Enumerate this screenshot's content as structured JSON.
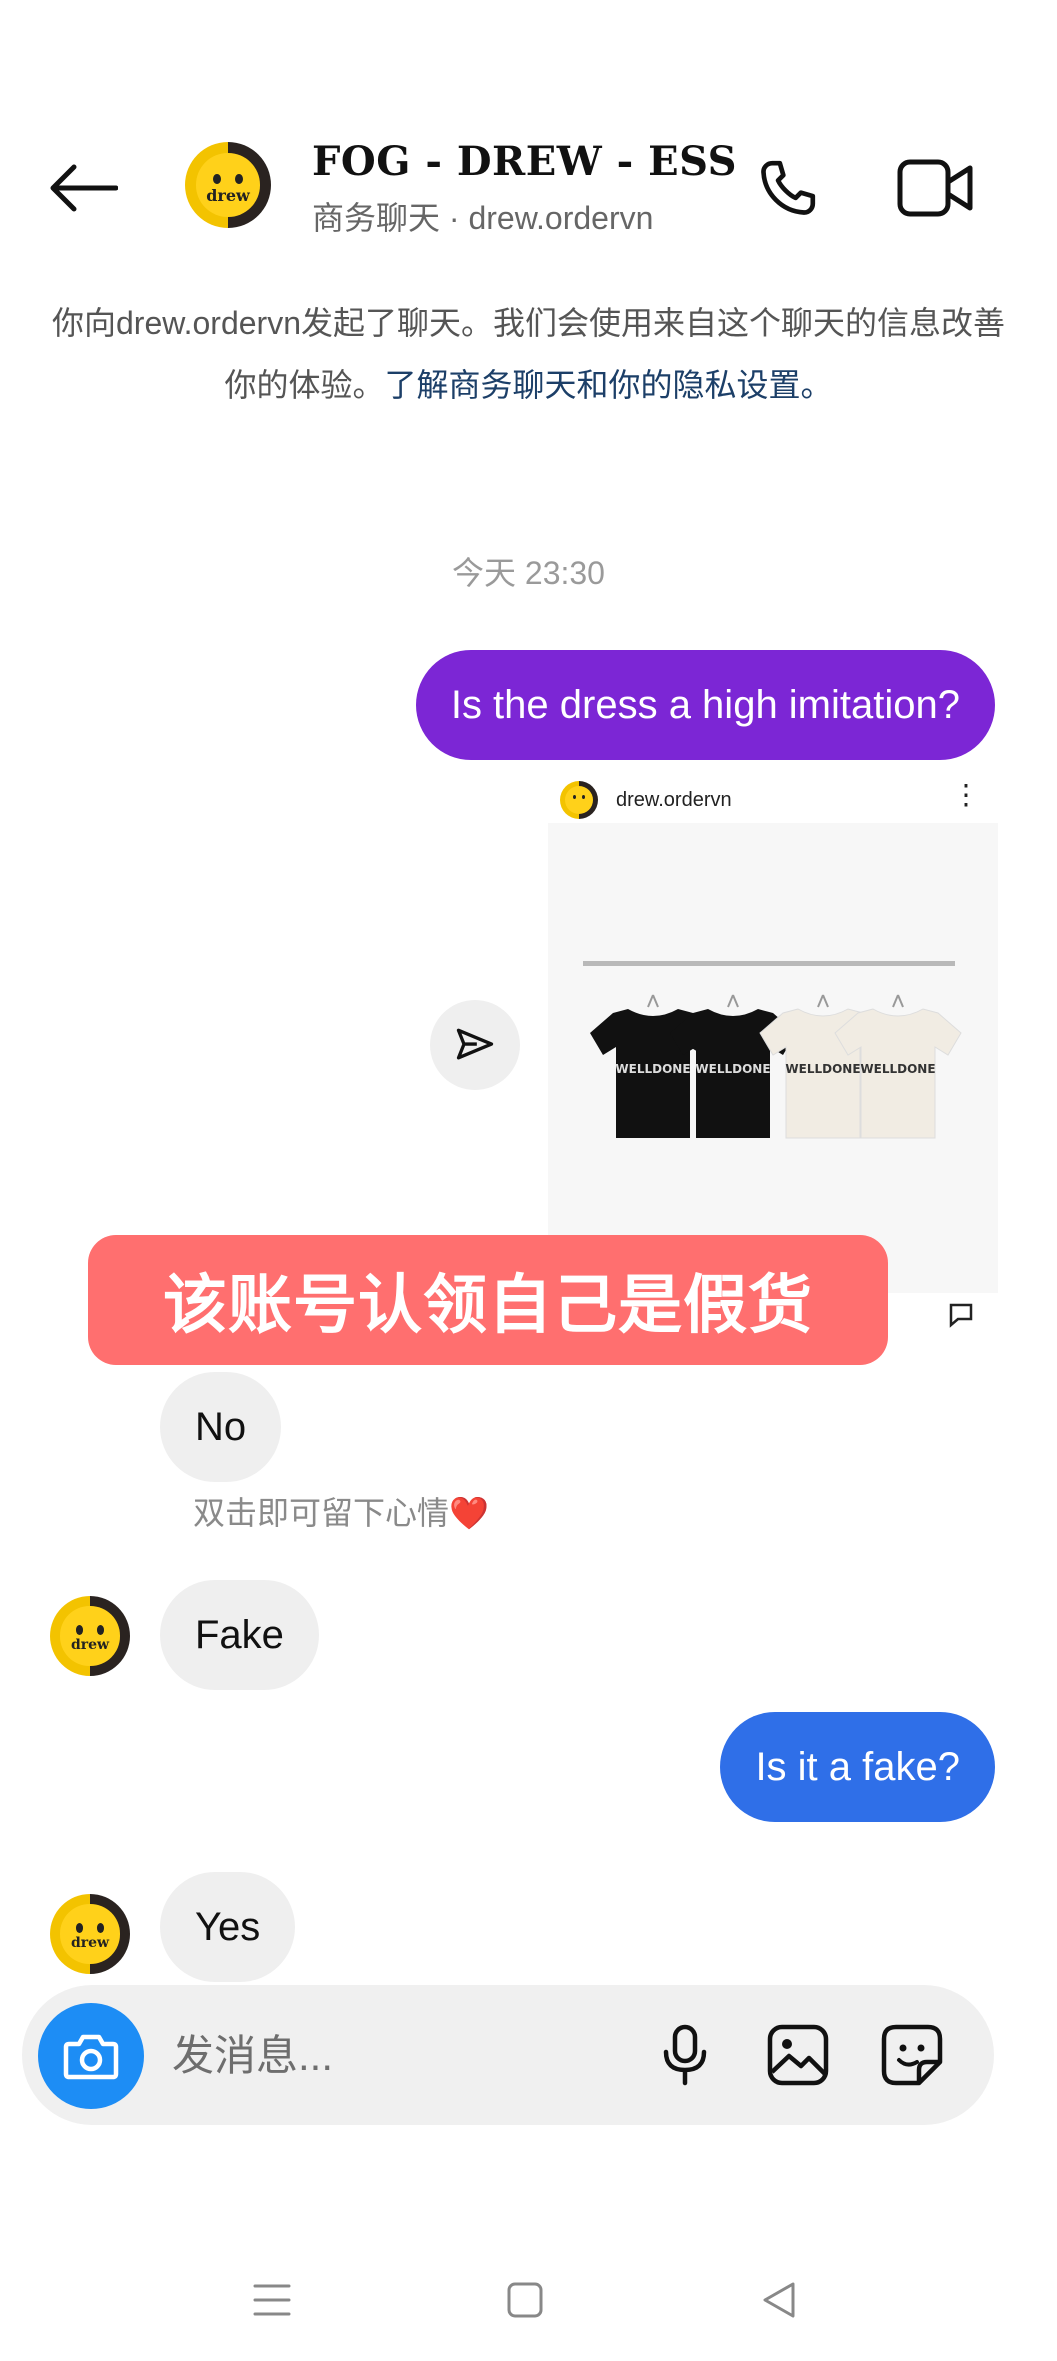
{
  "header": {
    "title": "FOG - DREW - ESS",
    "subtitle": "商务聊天 · drew.ordervn",
    "avatar_text": "drew"
  },
  "notice": {
    "text": "你向drew.ordervn发起了聊天。我们会使用来自这个聊天的信息改善你的体验。",
    "link": "了解商务聊天和你的隐私设置。"
  },
  "timestamp": "今天 23:30",
  "messages": [
    {
      "from": "me",
      "text": "Is the dress a high imitation?"
    },
    {
      "from": "me",
      "type": "shared_post",
      "username": "drew.ordervn"
    },
    {
      "from": "them",
      "text": "No"
    },
    {
      "from": "them",
      "text": "Fake"
    },
    {
      "from": "me",
      "text": "Is it a fake?"
    },
    {
      "from": "them",
      "text": "Yes"
    }
  ],
  "shared_post": {
    "username": "drew.ordervn",
    "more": "⋮",
    "shirt_brand": "WELLDONE",
    "shirt_colors": [
      "#111111",
      "#111111",
      "#f1ece3",
      "#f1ece3"
    ]
  },
  "overlay_caption": "该账号认领自己是假货",
  "reaction_hint": "双击即可留下心情",
  "reaction_emoji": "❤️",
  "composer": {
    "placeholder": "发消息..."
  },
  "icons": {
    "back": "back-arrow-icon",
    "call": "phone-icon",
    "video": "video-camera-icon",
    "share": "send-icon",
    "camera": "camera-icon",
    "mic": "microphone-icon",
    "gallery": "gallery-icon",
    "sticker": "sticker-icon"
  },
  "colors": {
    "outgoing_purple": "#7c26d5",
    "outgoing_blue": "#2f6fe8",
    "incoming_gray": "#efefef",
    "overlay_red": "#ff6f6f",
    "camera_button": "#1d8df5",
    "link": "#1c3f68"
  }
}
